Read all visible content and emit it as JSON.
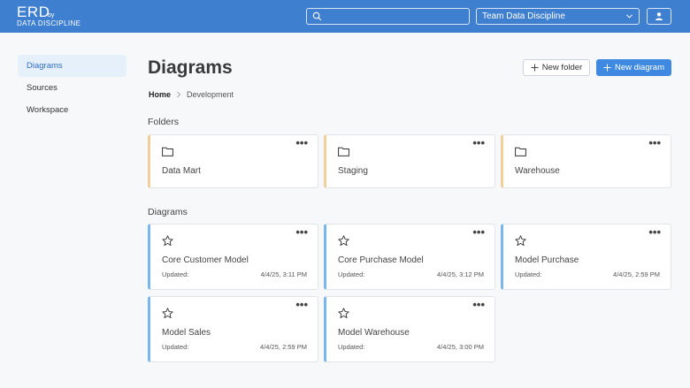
{
  "header": {
    "logo_main": "ERD",
    "logo_by": "by",
    "logo_sub": "DATA DISCIPLINE",
    "search_placeholder": "",
    "team_selected": "Team Data Discipline"
  },
  "sidebar": {
    "items": [
      {
        "label": "Diagrams",
        "active": true
      },
      {
        "label": "Sources",
        "active": false
      },
      {
        "label": "Workspace",
        "active": false
      }
    ]
  },
  "main": {
    "title": "Diagrams",
    "new_folder_label": "New folder",
    "new_diagram_label": "New diagram",
    "breadcrumb": {
      "home": "Home",
      "current": "Development"
    },
    "folders_heading": "Folders",
    "diagrams_heading": "Diagrams",
    "menu_glyph": "•••",
    "folders": [
      {
        "name": "Data Mart"
      },
      {
        "name": "Staging"
      },
      {
        "name": "Warehouse"
      }
    ],
    "diagrams": [
      {
        "name": "Core Customer Model",
        "updated_label": "Updated:",
        "updated": "4/4/25, 3:11 PM"
      },
      {
        "name": "Core Purchase Model",
        "updated_label": "Updated:",
        "updated": "4/4/25, 3:12 PM"
      },
      {
        "name": "Model Purchase",
        "updated_label": "Updated:",
        "updated": "4/4/25, 2:59 PM"
      },
      {
        "name": "Model Sales",
        "updated_label": "Updated:",
        "updated": "4/4/25, 2:59 PM"
      },
      {
        "name": "Model Warehouse",
        "updated_label": "Updated:",
        "updated": "4/4/25, 3:00 PM"
      }
    ]
  },
  "colors": {
    "header_bg": "#3f7fd0",
    "primary_button": "#3f8ae0",
    "folder_accent": "#f1cf9a",
    "diagram_accent": "#7ab6ec",
    "sidebar_active_bg": "#e6f0fb"
  },
  "icons": {
    "search": "search-icon",
    "team_dropdown": "chevron-down-icon",
    "user": "user-icon",
    "folder": "folder-icon",
    "favorite": "star-icon",
    "more": "more-icon",
    "add": "plus-icon",
    "breadcrumb_separator": "chevron-right-icon"
  }
}
